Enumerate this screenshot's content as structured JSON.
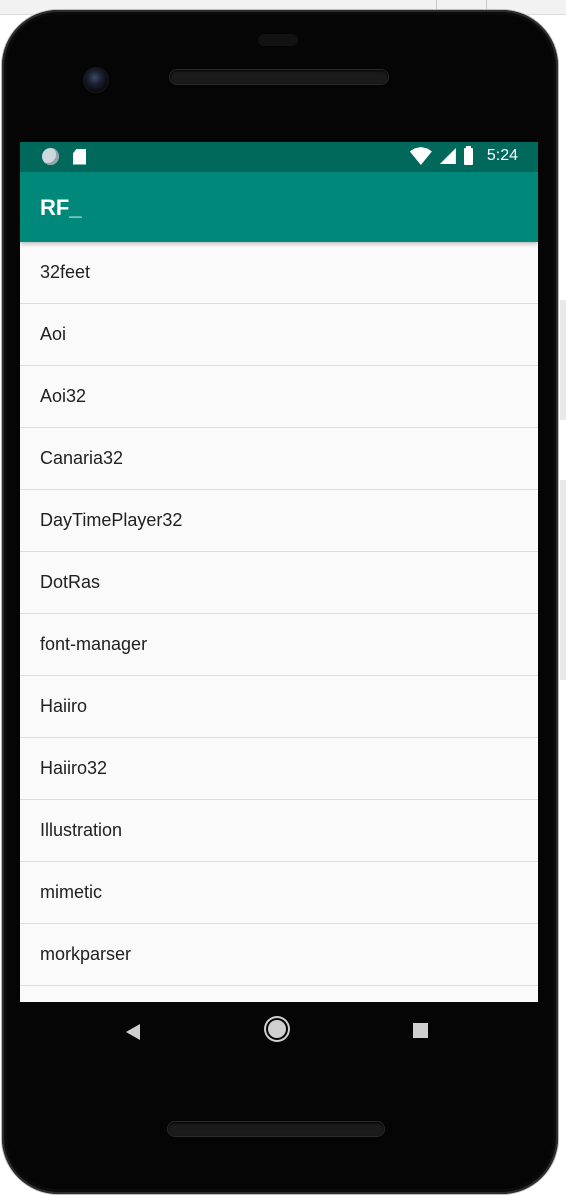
{
  "status_bar": {
    "time": "5:24",
    "icons": [
      "circle-icon",
      "sd-card-icon",
      "wifi-icon",
      "signal-icon",
      "battery-icon"
    ]
  },
  "app_bar": {
    "title": "RF_",
    "color": "#00897b",
    "status_color": "#00695c"
  },
  "list": {
    "items": [
      "32feet",
      "Aoi",
      "Aoi32",
      "Canaria32",
      "DayTimePlayer32",
      "DotRas",
      "font-manager",
      "Haiiro",
      "Haiiro32",
      "Illustration",
      "mimetic",
      "morkparser",
      ""
    ]
  },
  "nav_bar": {
    "icons": [
      "back-icon",
      "home-icon",
      "recents-icon"
    ]
  }
}
